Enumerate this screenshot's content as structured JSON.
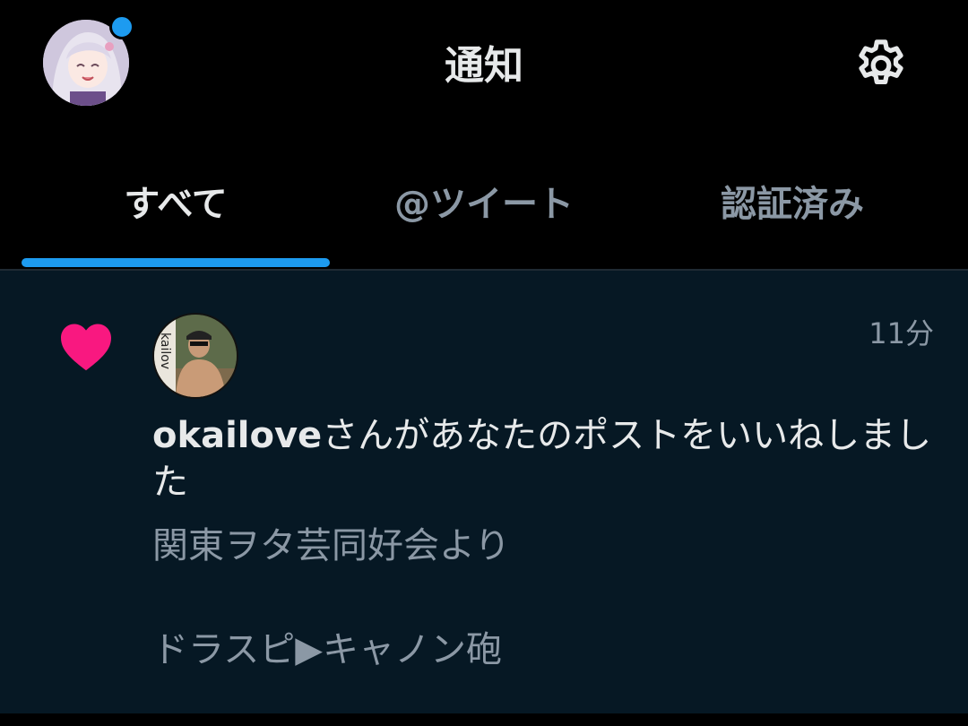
{
  "header": {
    "title": "通知",
    "avatar_icon": "profile-avatar",
    "settings_icon": "gear-icon",
    "accent_color": "#1d9bf0"
  },
  "tabs": [
    {
      "label": "すべて",
      "active": true
    },
    {
      "label": "@ツイート",
      "active": false
    },
    {
      "label": "認証済み",
      "active": false
    }
  ],
  "notifications": [
    {
      "type_icon": "heart-icon",
      "heart_color": "#f91880",
      "time": "11分",
      "user": "okailove",
      "action_text": "さんがあなたのポストをいいねしました",
      "post_text": "関東ヲタ芸同好会より\n\nドラスピ▶キャノン砲"
    }
  ]
}
